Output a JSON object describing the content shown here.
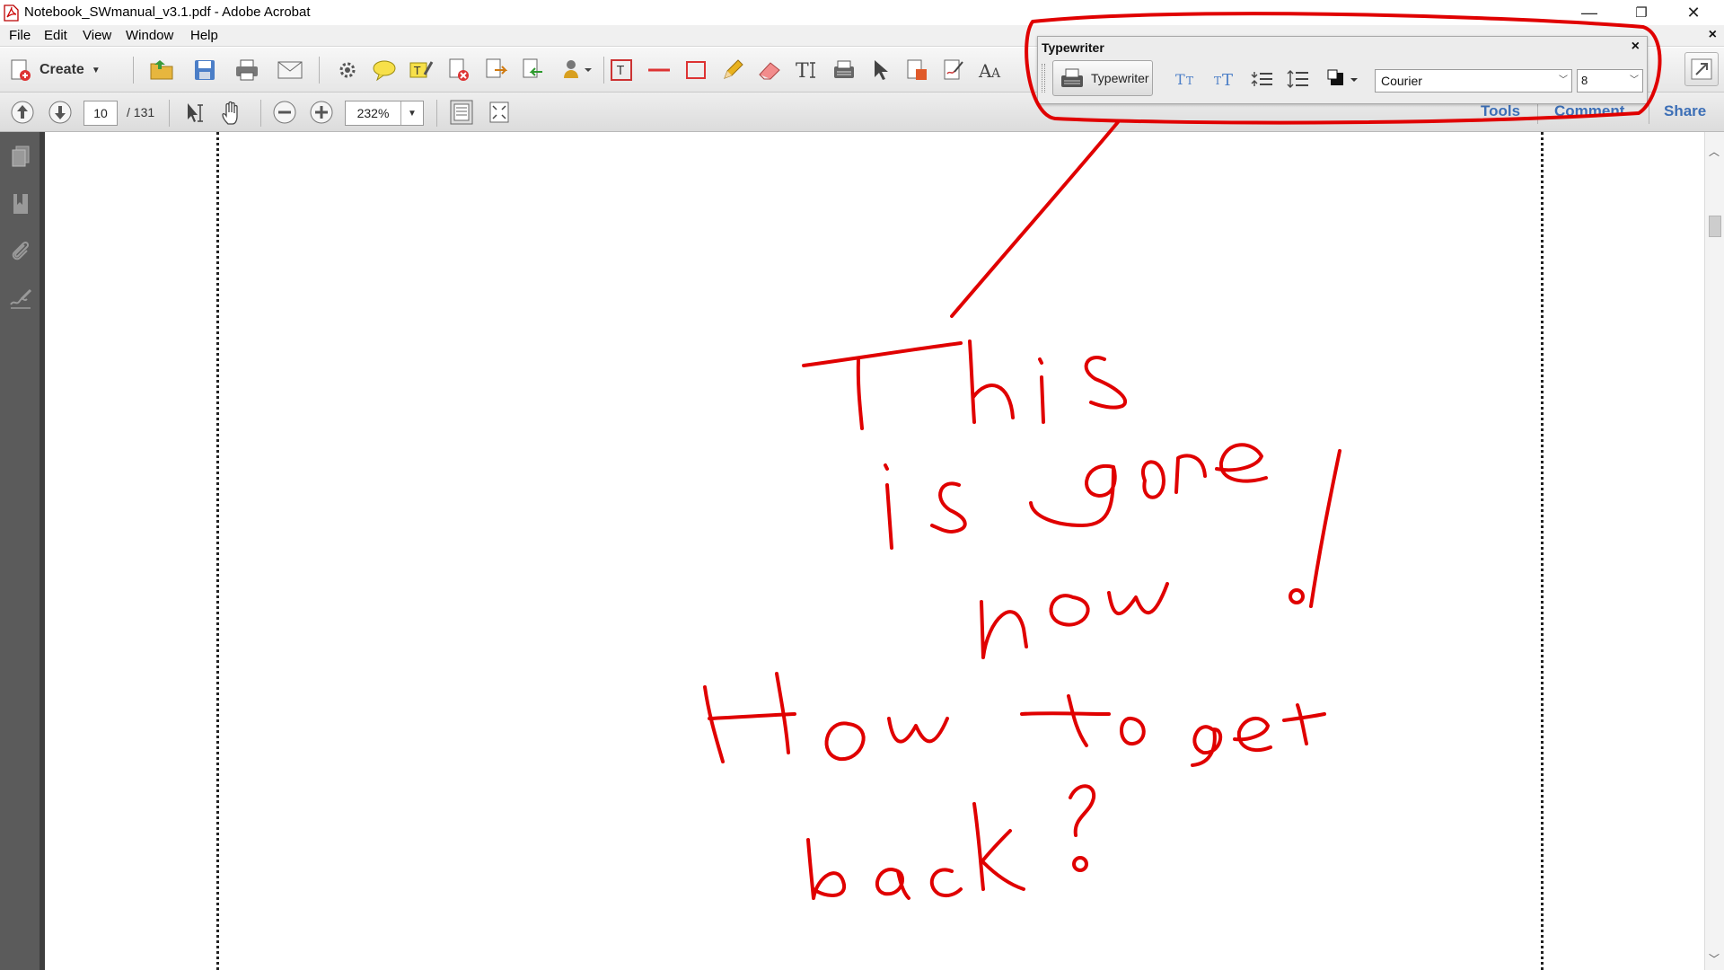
{
  "window": {
    "title": "Notebook_SWmanual_v3.1.pdf - Adobe Acrobat",
    "minimize_glyph": "—",
    "restore_glyph": "❐",
    "close_glyph": "✕"
  },
  "menu": {
    "items": [
      "File",
      "Edit",
      "View",
      "Window",
      "Help"
    ],
    "close_glyph": "×"
  },
  "toolbar": {
    "create_label": "Create",
    "page_current": "10",
    "page_total": "/ 131",
    "zoom": "232%",
    "links": [
      "Tools",
      "Comment",
      "Share"
    ]
  },
  "typewriter_panel": {
    "title": "Typewriter",
    "close_glyph": "×",
    "button_label": "Typewriter",
    "font": "Courier",
    "size": "8"
  },
  "annotation": {
    "handwriting": [
      "This",
      "is gone",
      "now!",
      "How to get",
      "back?"
    ],
    "color": "#e00000"
  },
  "colors": {
    "link": "#3d6fb6",
    "leftnav": "#5b5b5b"
  }
}
